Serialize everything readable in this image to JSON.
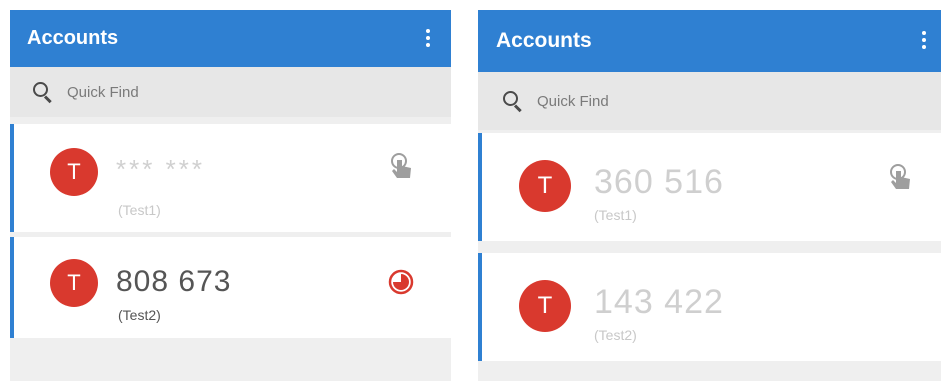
{
  "left_screen": {
    "appbar": {
      "title": "Accounts",
      "menu_icon": "more-vert-icon"
    },
    "search": {
      "placeholder": "Quick Find",
      "icon": "search-icon"
    },
    "accounts": [
      {
        "avatar_letter": "T",
        "code": "*** ***",
        "name": "(Test1)",
        "state": "hidden",
        "action_icon": "tap-to-reveal-icon"
      },
      {
        "avatar_letter": "T",
        "code": "808 673",
        "name": "(Test2)",
        "state": "active",
        "action_icon": "countdown-timer-icon",
        "timer_remaining_fraction": 0.75
      }
    ]
  },
  "right_screen": {
    "appbar": {
      "title": "Accounts",
      "menu_icon": "more-vert-icon"
    },
    "search": {
      "placeholder": "Quick Find",
      "icon": "search-icon"
    },
    "accounts": [
      {
        "avatar_letter": "T",
        "code": "360 516",
        "name": "(Test1)",
        "state": "dim",
        "action_icon": "tap-to-reveal-icon"
      },
      {
        "avatar_letter": "T",
        "code": "143 422",
        "name": "(Test2)",
        "state": "dim"
      }
    ]
  },
  "colors": {
    "appbar": "#2f80d2",
    "avatar": "#d9392e",
    "accent_border": "#2f80d2",
    "timer": "#d9392e"
  }
}
